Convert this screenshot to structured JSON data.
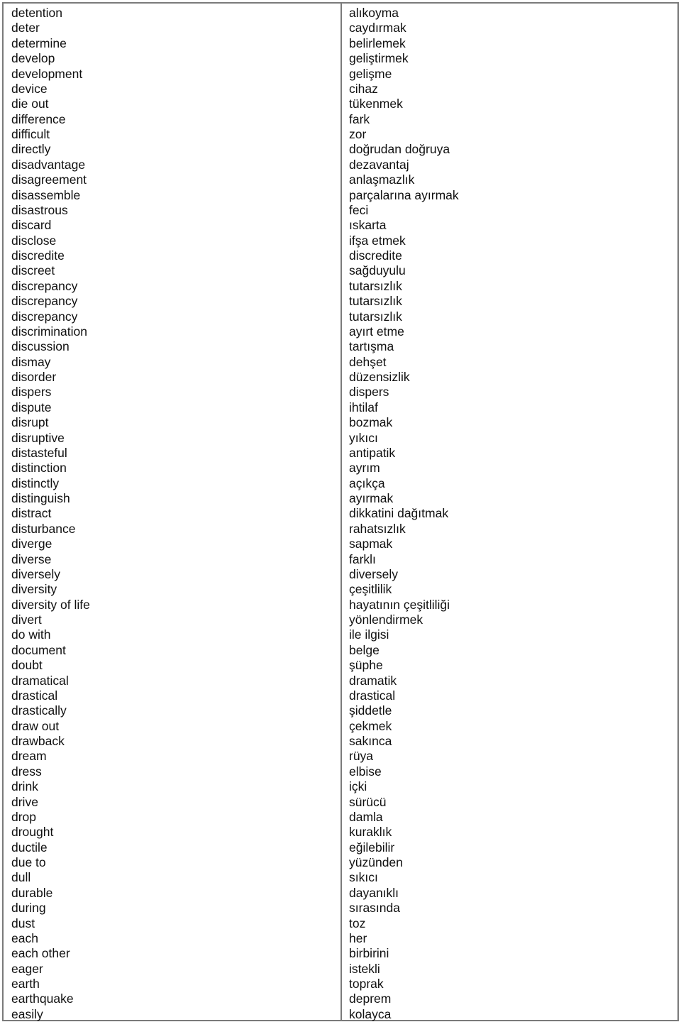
{
  "english": [
    "detention",
    "deter",
    "determine",
    "develop",
    "development",
    "device",
    "die out",
    "difference",
    "difficult",
    "directly",
    "disadvantage",
    "disagreement",
    "disassemble",
    "disastrous",
    "discard",
    "disclose",
    "discredite",
    "discreet",
    "discrepancy",
    "discrepancy",
    "discrepancy",
    "discrimination",
    "discussion",
    "dismay",
    "disorder",
    "dispers",
    "dispute",
    "disrupt",
    "disruptive",
    "distasteful",
    "distinction",
    "distinctly",
    "distinguish",
    "distract",
    "disturbance",
    "diverge",
    "diverse",
    "diversely",
    "diversity",
    "diversity of life",
    "divert",
    "do with",
    "document",
    "doubt",
    "dramatical",
    "drastical",
    "drastically",
    "draw out",
    "drawback",
    "dream",
    "dress",
    "drink",
    "drive",
    "drop",
    "drought",
    "ductile",
    "due to",
    "dull",
    "durable",
    "during",
    "dust",
    "each",
    "each other",
    "eager",
    "earth",
    "earthquake",
    "easily"
  ],
  "turkish": [
    "alıkoyma",
    "caydırmak",
    "belirlemek",
    "geliştirmek",
    "gelişme",
    "cihaz",
    "tükenmek",
    "fark",
    "zor",
    "doğrudan doğruya",
    "dezavantaj",
    "anlaşmazlık",
    "parçalarına ayırmak",
    "feci",
    "ıskarta",
    "ifşa etmek",
    "discredite",
    "sağduyulu",
    "tutarsızlık",
    "tutarsızlık",
    "tutarsızlık",
    "ayırt etme",
    "tartışma",
    "dehşet",
    "düzensizlik",
    "dispers",
    "ihtilaf",
    "bozmak",
    "yıkıcı",
    "antipatik",
    "ayrım",
    "açıkça",
    "ayırmak",
    "dikkatini dağıtmak",
    "rahatsızlık",
    "sapmak",
    "farklı",
    "diversely",
    "çeşitlilik",
    "hayatının çeşitliliği",
    "yönlendirmek",
    "ile ilgisi",
    "belge",
    "şüphe",
    "dramatik",
    "drastical",
    "şiddetle",
    "çekmek",
    "sakınca",
    "rüya",
    "elbise",
    "içki",
    "sürücü",
    "damla",
    "kuraklık",
    "eğilebilir",
    "yüzünden",
    "sıkıcı",
    "dayanıklı",
    "sırasında",
    "toz",
    "her",
    "birbirini",
    "istekli",
    "toprak",
    "deprem",
    "kolayca"
  ]
}
